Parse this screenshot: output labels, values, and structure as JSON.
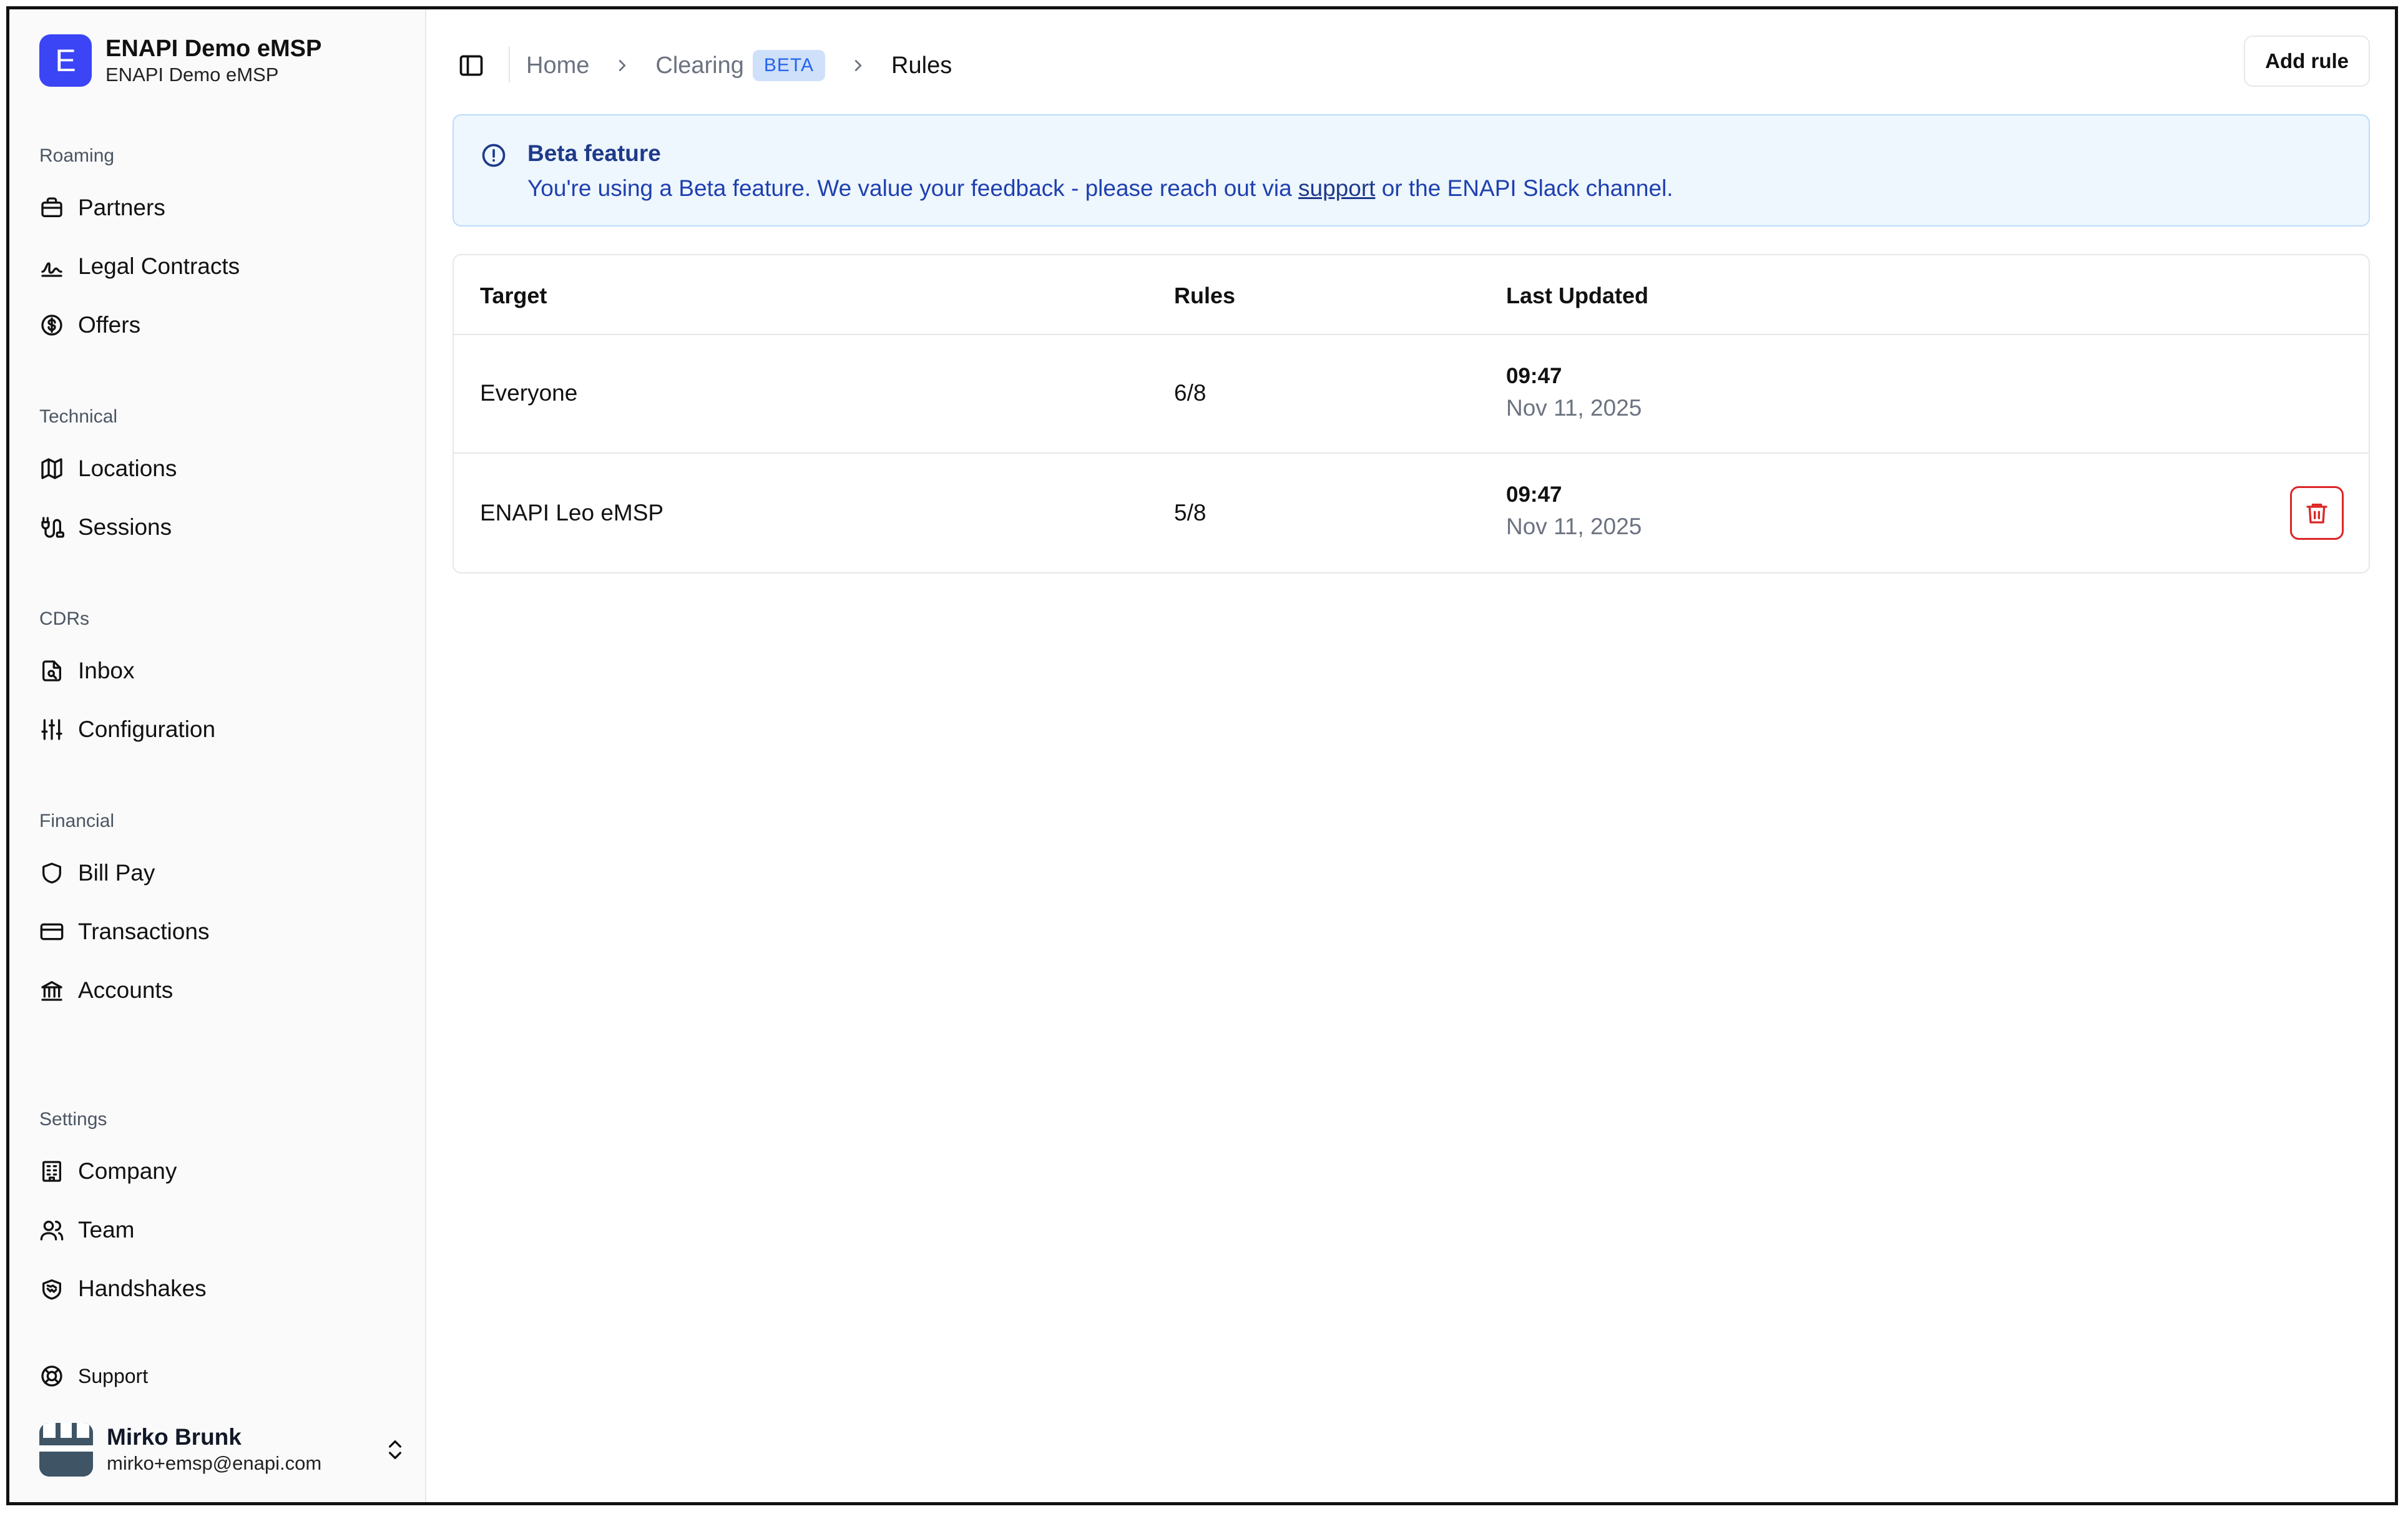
{
  "org": {
    "logo_letter": "E",
    "name": "ENAPI Demo eMSP",
    "subtitle": "ENAPI Demo eMSP"
  },
  "sidebar": {
    "sections": [
      {
        "label": "Roaming",
        "items": [
          {
            "label": "Partners",
            "icon": "briefcase-icon"
          },
          {
            "label": "Legal Contracts",
            "icon": "signature-icon"
          },
          {
            "label": "Offers",
            "icon": "dollar-circle-icon"
          }
        ]
      },
      {
        "label": "Technical",
        "items": [
          {
            "label": "Locations",
            "icon": "map-icon"
          },
          {
            "label": "Sessions",
            "icon": "plug-icon"
          }
        ]
      },
      {
        "label": "CDRs",
        "items": [
          {
            "label": "Inbox",
            "icon": "file-search-icon"
          },
          {
            "label": "Configuration",
            "icon": "sliders-icon"
          }
        ]
      },
      {
        "label": "Financial",
        "items": [
          {
            "label": "Bill Pay",
            "icon": "shield-icon"
          },
          {
            "label": "Transactions",
            "icon": "credit-card-icon"
          },
          {
            "label": "Accounts",
            "icon": "bank-icon"
          }
        ]
      },
      {
        "label": "Settings",
        "items": [
          {
            "label": "Company",
            "icon": "building-icon"
          },
          {
            "label": "Team",
            "icon": "users-icon"
          },
          {
            "label": "Handshakes",
            "icon": "handshake-icon"
          }
        ]
      }
    ],
    "support": "Support"
  },
  "user": {
    "name": "Mirko Brunk",
    "email": "mirko+emsp@enapi.com"
  },
  "breadcrumb": {
    "home": "Home",
    "clearing": "Clearing",
    "badge": "BETA",
    "current": "Rules"
  },
  "toolbar": {
    "add_rule": "Add rule"
  },
  "banner": {
    "title": "Beta feature",
    "message_before": "You're using a Beta feature. We value your feedback - please reach out via ",
    "link": "support",
    "message_after": " or the ENAPI Slack channel."
  },
  "table": {
    "columns": [
      "Target",
      "Rules",
      "Last Updated"
    ],
    "rows": [
      {
        "target": "Everyone",
        "rules": "6/8",
        "time": "09:47",
        "date": "Nov 11, 2025",
        "deletable": false
      },
      {
        "target": "ENAPI Leo eMSP",
        "rules": "5/8",
        "time": "09:47",
        "date": "Nov 11, 2025",
        "deletable": true
      }
    ]
  },
  "colors": {
    "accent": "#3b45f5",
    "beta_bg": "#cfe0fb",
    "banner_bg": "#eef6fe",
    "danger": "#dc2626"
  }
}
